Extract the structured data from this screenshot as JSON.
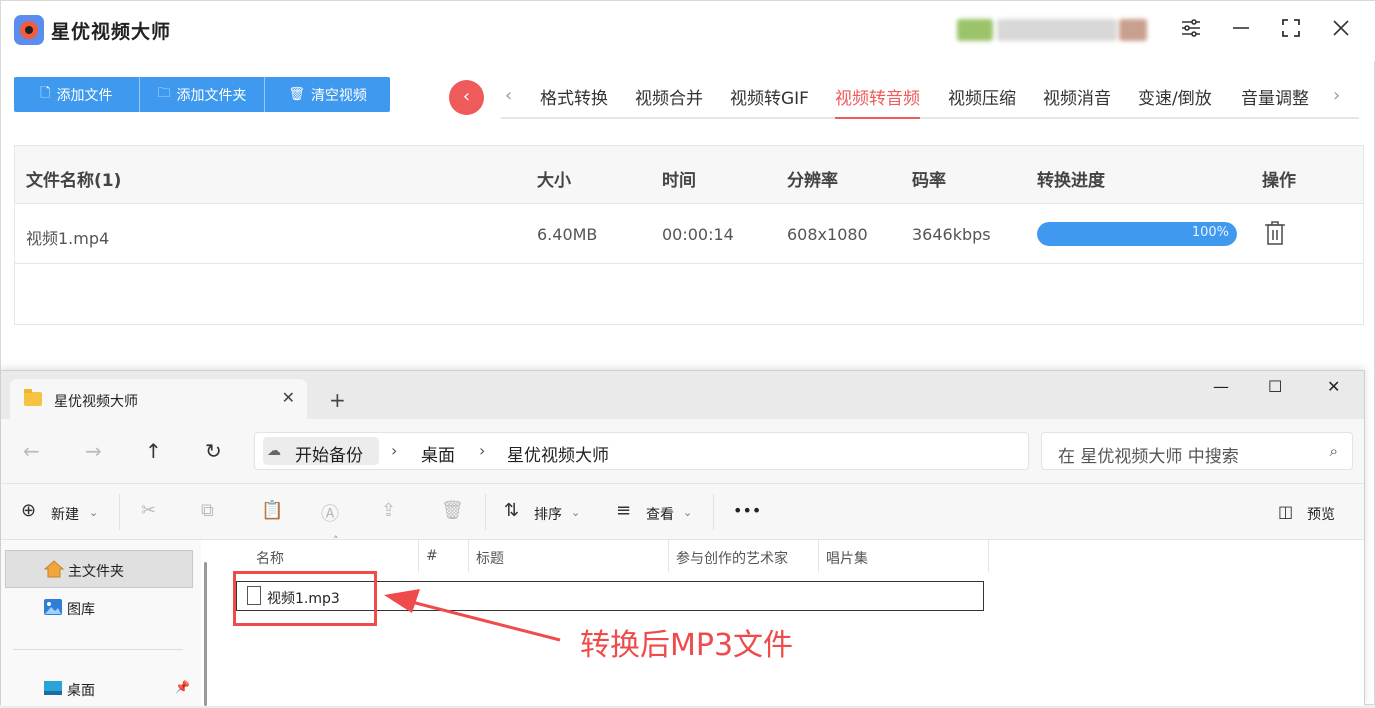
{
  "app": {
    "title": "星优视频大师",
    "toolbar": {
      "add_file": "添加文件",
      "add_folder": "添加文件夹",
      "clear_video": "清空视频"
    },
    "tabs": [
      {
        "label": "格式转换"
      },
      {
        "label": "视频合并"
      },
      {
        "label": "视频转GIF"
      },
      {
        "label": "视频转音频",
        "active": true
      },
      {
        "label": "视频压缩"
      },
      {
        "label": "视频消音"
      },
      {
        "label": "变速/倒放"
      },
      {
        "label": "音量调整"
      }
    ],
    "table": {
      "headers": {
        "name": "文件名称(1)",
        "size": "大小",
        "time": "时间",
        "resolution": "分辨率",
        "bitrate": "码率",
        "progress": "转换进度",
        "action": "操作"
      },
      "rows": [
        {
          "name": "视频1.mp4",
          "size": "6.40MB",
          "time": "00:00:14",
          "resolution": "608x1080",
          "bitrate": "3646kbps",
          "progress_label": "100%",
          "progress": 1.0
        }
      ]
    },
    "colors": {
      "accent_blue": "#3f9aef",
      "accent_red": "#ef5a5a"
    }
  },
  "explorer": {
    "tab_title": "星优视频大师",
    "address": [
      "开始备份",
      "桌面",
      "星优视频大师"
    ],
    "search_placeholder": "在 星优视频大师 中搜索",
    "commands": {
      "new": "新建",
      "sort": "排序",
      "view": "查看",
      "more": "•••",
      "preview": "预览"
    },
    "sidebar": [
      {
        "label": "主文件夹",
        "icon": "home-icon",
        "selected": true
      },
      {
        "label": "图库",
        "icon": "gallery-icon"
      },
      {
        "label": "桌面",
        "icon": "desktop-icon"
      }
    ],
    "columns": [
      "名称",
      "#",
      "标题",
      "参与创作的艺术家",
      "唱片集"
    ],
    "files": [
      {
        "name": "视频1.mp3"
      }
    ]
  },
  "annotation": {
    "text": "转换后MP3文件",
    "color": "#ef4b4b"
  }
}
